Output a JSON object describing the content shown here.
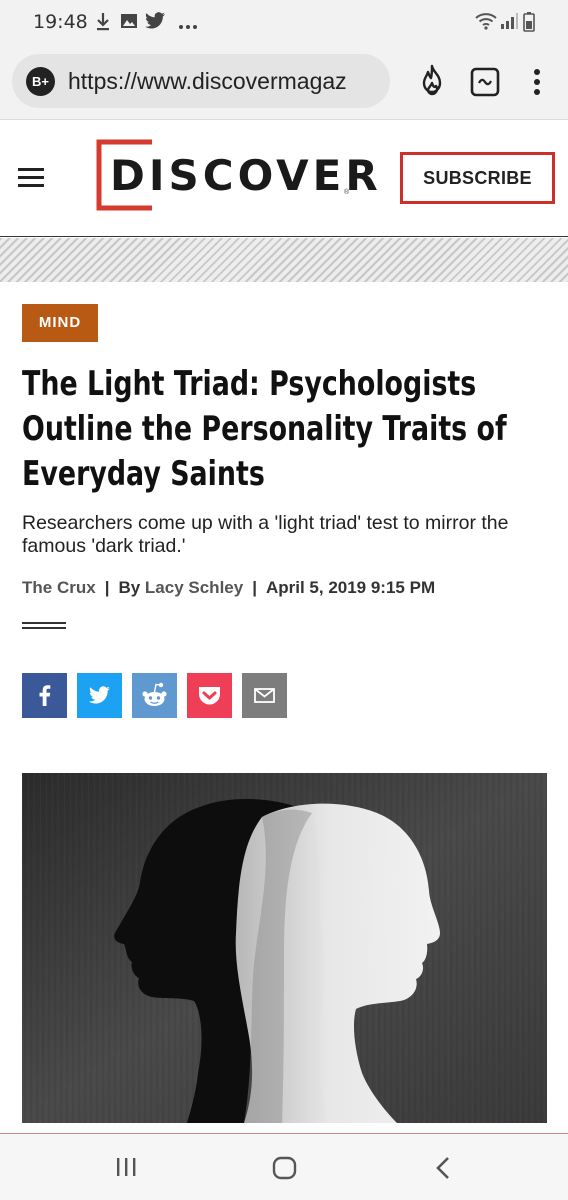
{
  "status_bar": {
    "time": "19:48",
    "left_icons": [
      "download-icon",
      "image-icon",
      "twitter-icon",
      "more-dots-icon"
    ],
    "right_icons": [
      "wifi-icon",
      "signal-icon",
      "battery-icon"
    ]
  },
  "browser": {
    "badge": "B+",
    "url": "https://www.discovermagaz",
    "icons": [
      "flame-icon",
      "tab-switcher-icon",
      "overflow-menu-icon"
    ]
  },
  "site_header": {
    "logo_text": "DISCOVER",
    "subscribe_label": "SUBSCRIBE",
    "colors": {
      "brand_red": "#d63a2f"
    }
  },
  "article": {
    "category": "MIND",
    "category_color": "#b95a14",
    "headline": "The Light Triad: Psychologists Outline the Personality Traits of Everyday Saints",
    "subhead": "Researchers come up with a 'light triad' test to mirror the famous 'dark triad.'",
    "byline": {
      "blog": "The Crux",
      "by": "By",
      "author": "Lacy Schley",
      "date": "April 5, 2019 9:15 PM"
    },
    "share_buttons": [
      {
        "name": "facebook-share-button",
        "icon": "facebook-icon",
        "color": "#3b5998"
      },
      {
        "name": "twitter-share-button",
        "icon": "twitter-icon",
        "color": "#1da1f2"
      },
      {
        "name": "reddit-share-button",
        "icon": "reddit-icon",
        "color": "#5f99cf"
      },
      {
        "name": "pocket-share-button",
        "icon": "pocket-icon",
        "color": "#ef3f56"
      },
      {
        "name": "email-share-button",
        "icon": "email-icon",
        "color": "#7d7d7d"
      }
    ]
  },
  "bottom_nav": {
    "icons": [
      "recent-apps-icon",
      "home-icon",
      "back-icon"
    ]
  }
}
